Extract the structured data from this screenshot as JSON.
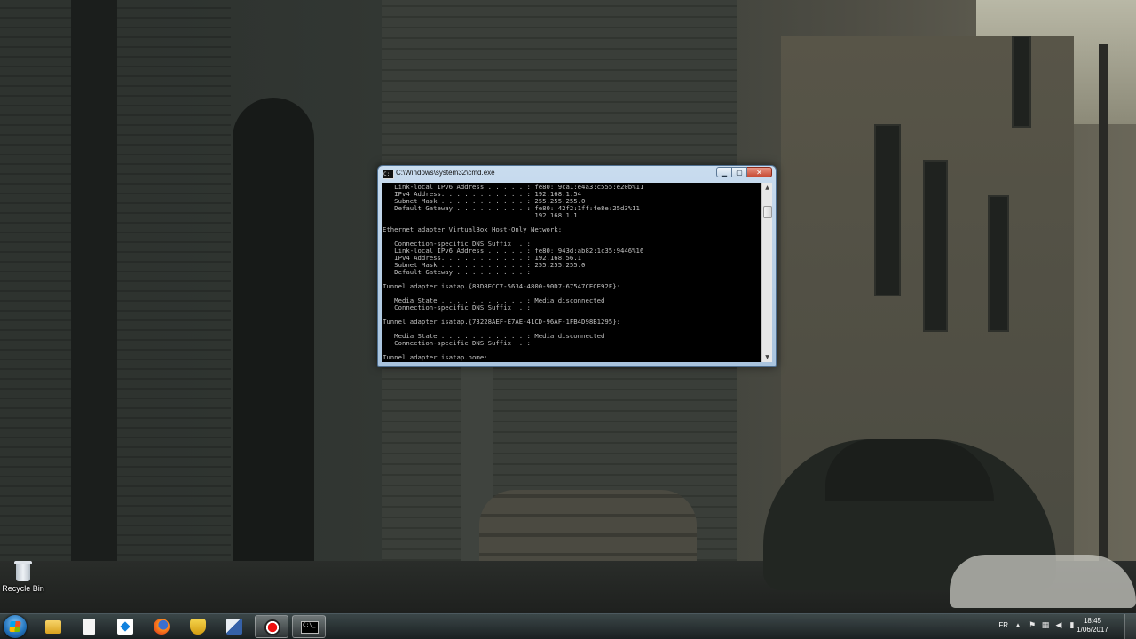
{
  "desktop": {
    "icons": [
      {
        "label": "Recycle Bin",
        "icon": "recycle-bin-icon"
      }
    ]
  },
  "cmd_window": {
    "title": "C:\\Windows\\system32\\cmd.exe",
    "buttons": {
      "minimize": "minimize",
      "maximize": "maximize",
      "close": "close"
    },
    "lines": [
      "   Link-local IPv6 Address . . . . . : fe80::9ca1:e4a3:c555:e20b%11",
      "   IPv4 Address. . . . . . . . . . . : 192.168.1.54",
      "   Subnet Mask . . . . . . . . . . . : 255.255.255.0",
      "   Default Gateway . . . . . . . . . : fe80::42f2:1ff:fe8e:25d3%11",
      "                                       192.168.1.1",
      "",
      "Ethernet adapter VirtualBox Host-Only Network:",
      "",
      "   Connection-specific DNS Suffix  . :",
      "   Link-local IPv6 Address . . . . . : fe80::943d:ab82:1c35:9446%16",
      "   IPv4 Address. . . . . . . . . . . : 192.168.56.1",
      "   Subnet Mask . . . . . . . . . . . : 255.255.255.0",
      "   Default Gateway . . . . . . . . . :",
      "",
      "Tunnel adapter isatap.{83D8ECC7-5634-4800-90D7-67547CECE92F}:",
      "",
      "   Media State . . . . . . . . . . . : Media disconnected",
      "   Connection-specific DNS Suffix  . :",
      "",
      "Tunnel adapter isatap.{73228AEF-E7AE-41CD-96AF-1FB4D98B1295}:",
      "",
      "   Media State . . . . . . . . . . . : Media disconnected",
      "   Connection-specific DNS Suffix  . :",
      "",
      "Tunnel adapter isatap.home:"
    ]
  },
  "taskbar": {
    "pinned": [
      {
        "name": "windows-explorer",
        "icon": "folder-icon"
      },
      {
        "name": "notepad",
        "icon": "file-icon"
      },
      {
        "name": "dropbox",
        "icon": "dropbox-icon"
      },
      {
        "name": "firefox",
        "icon": "firefox-icon"
      },
      {
        "name": "teapot-app",
        "icon": "teapot-icon"
      },
      {
        "name": "network-app",
        "icon": "network-icon"
      },
      {
        "name": "screen-recorder",
        "icon": "record-icon"
      },
      {
        "name": "command-prompt",
        "icon": "cmd-icon",
        "active": true
      }
    ],
    "tray": {
      "language": "FR",
      "time": "18:45",
      "date": "1/06/2017",
      "icons": [
        "chevron-up-icon",
        "flag-icon",
        "network-icon",
        "volume-icon",
        "battery-icon"
      ]
    }
  }
}
